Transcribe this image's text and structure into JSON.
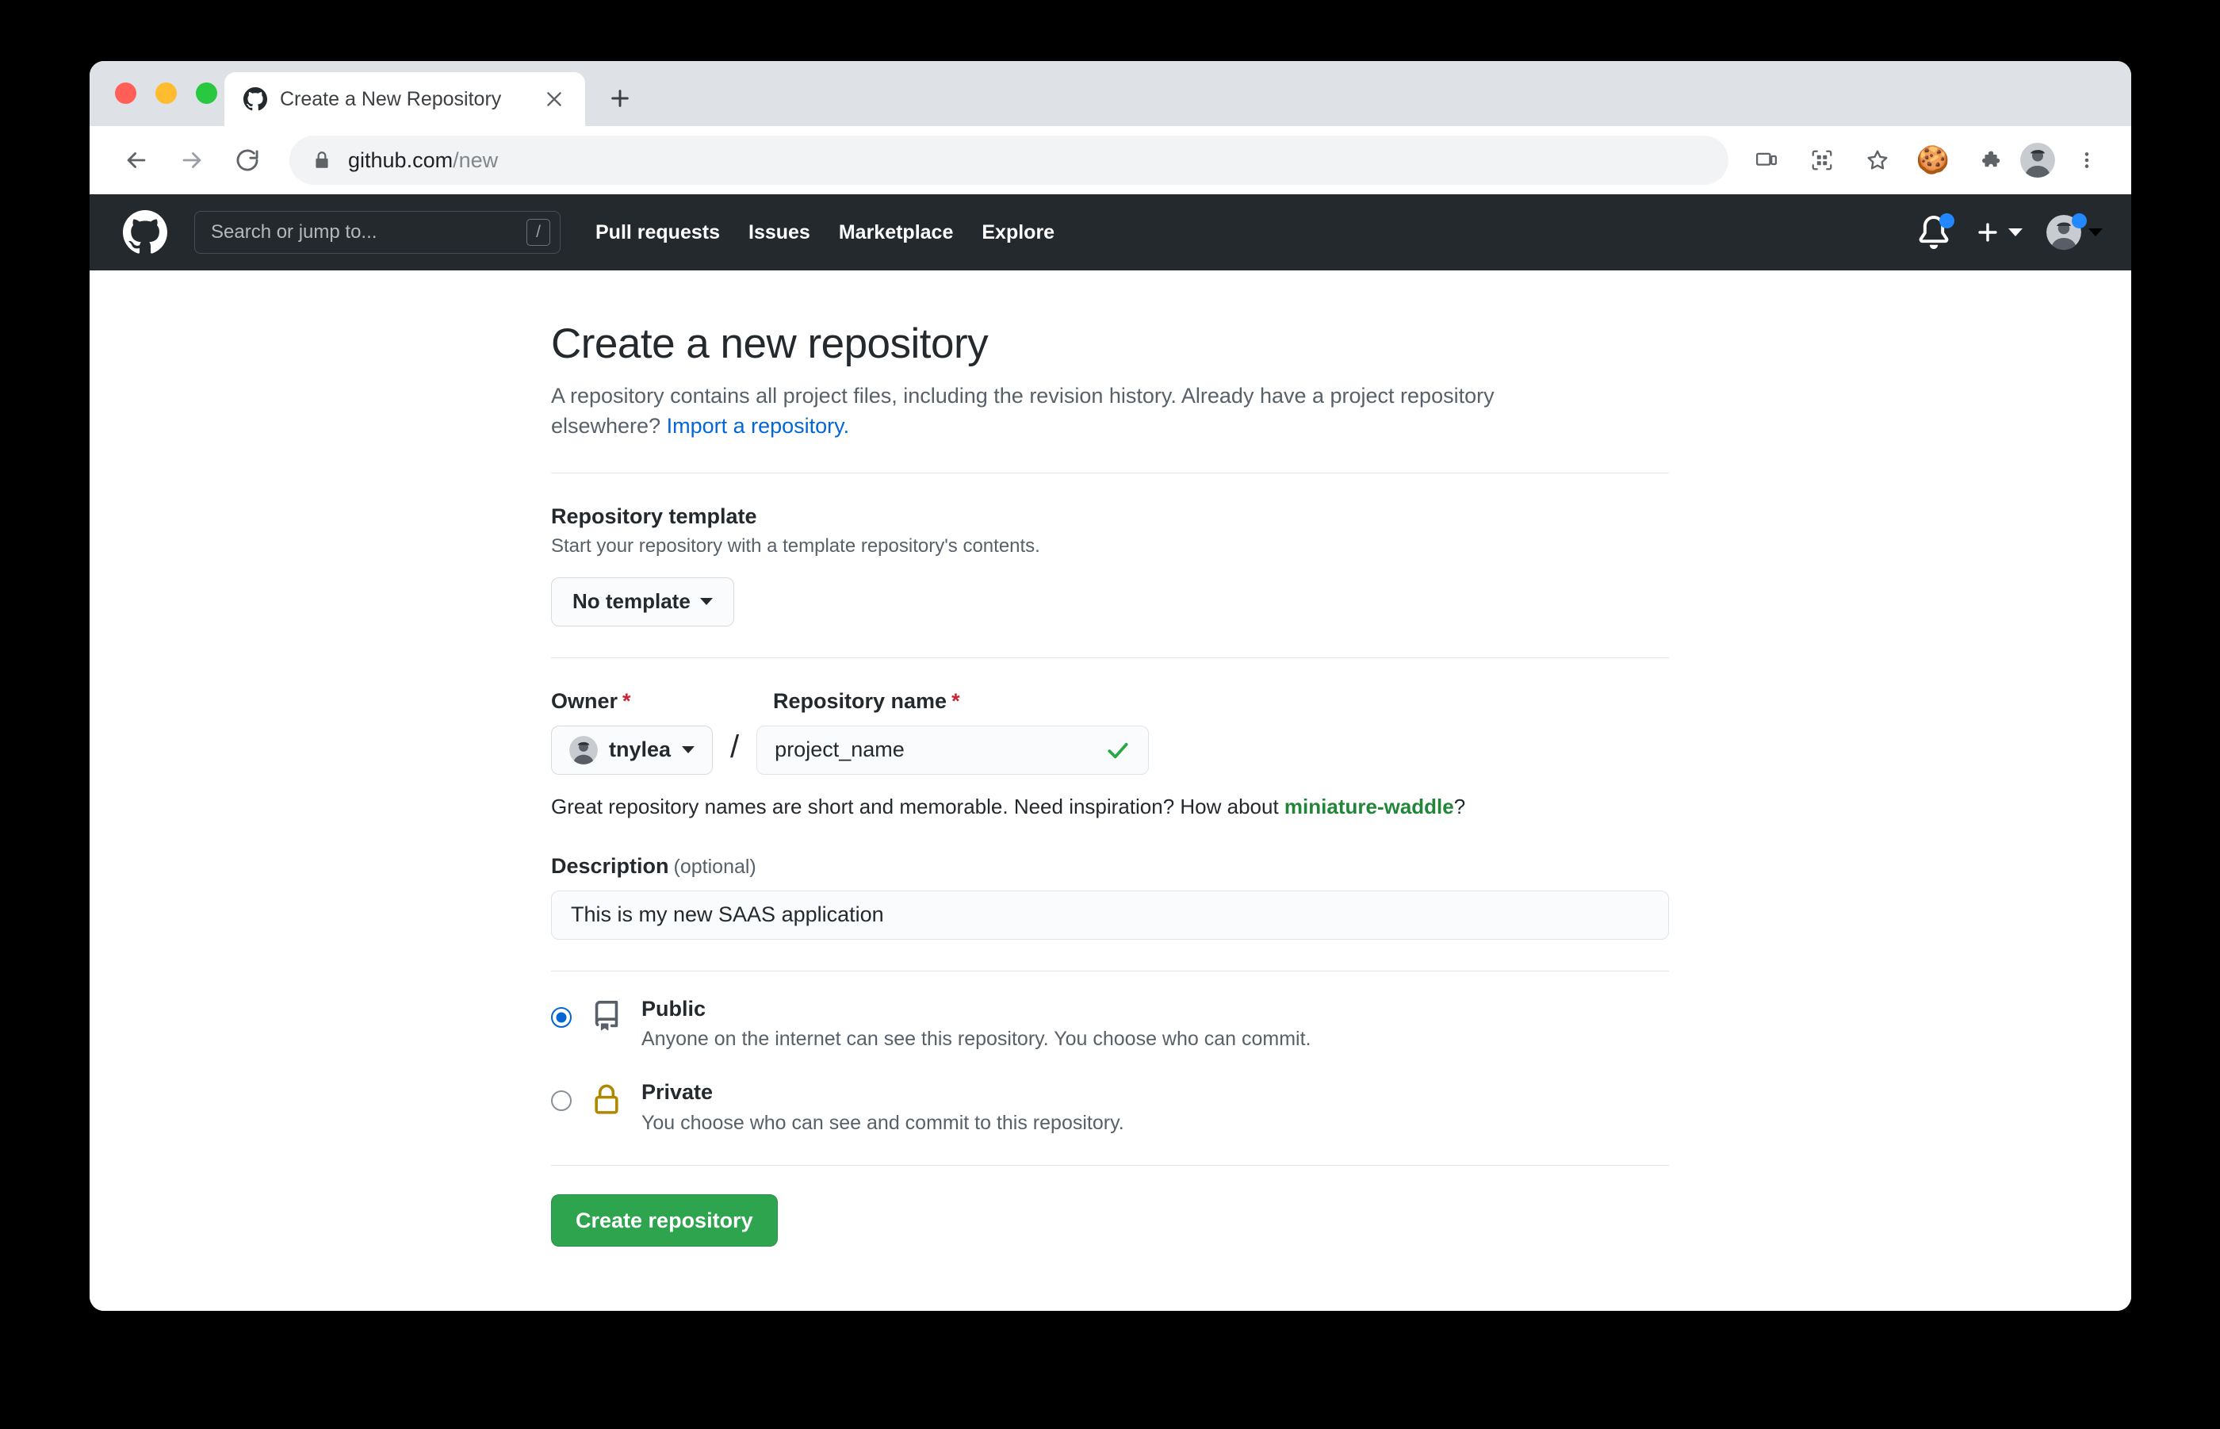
{
  "browser": {
    "tab": {
      "title": "Create a New Repository",
      "favicon": "github-icon",
      "close": "close-icon"
    },
    "new_tab_label": "+",
    "toolbar": {
      "back": "back-arrow-icon",
      "forward": "forward-arrow-icon",
      "reload": "reload-icon",
      "lock": "lock-icon",
      "url_domain": "github.com",
      "url_path": "/new",
      "icons": [
        "cast-icon",
        "qr-code-icon",
        "star-icon",
        "cookie-icon",
        "extensions-puzzle-icon",
        "profile-avatar",
        "three-dot-menu-icon"
      ]
    }
  },
  "gh_header": {
    "logo": "github-octocat-logo",
    "search_placeholder": "Search or jump to...",
    "search_shortcut": "/",
    "nav": [
      {
        "label": "Pull requests"
      },
      {
        "label": "Issues"
      },
      {
        "label": "Marketplace"
      },
      {
        "label": "Explore"
      }
    ],
    "notifications_icon": "bell-icon",
    "create_new_icon": "plus-icon",
    "avatar": "user-avatar"
  },
  "main": {
    "title": "Create a new repository",
    "description_prefix": "A repository contains all project files, including the revision history. Already have a project repository elsewhere? ",
    "description_link": "Import a repository.",
    "template": {
      "title": "Repository template",
      "subtitle": "Start your repository with a template repository's contents.",
      "button_label": "No template"
    },
    "owner": {
      "label": "Owner",
      "required_mark": "*",
      "value": "tnylea"
    },
    "repo_name": {
      "label": "Repository name",
      "required_mark": "*",
      "value": "project_name",
      "valid_icon": "check-icon"
    },
    "separator": "/",
    "name_hint_prefix": "Great repository names are short and memorable. Need inspiration? How about ",
    "name_hint_suggestion": "miniature-waddle",
    "name_hint_suffix": "?",
    "description_field": {
      "label": "Description",
      "optional": "(optional)",
      "value": "This is my new SAAS application"
    },
    "visibility": [
      {
        "id": "public",
        "title": "Public",
        "subtitle": "Anyone on the internet can see this repository. You choose who can commit.",
        "icon": "repo-book-icon",
        "selected": true
      },
      {
        "id": "private",
        "title": "Private",
        "subtitle": "You choose who can see and commit to this repository.",
        "icon": "lock-icon",
        "selected": false
      }
    ],
    "submit_label": "Create repository"
  },
  "colors": {
    "gh_header_bg": "#24292e",
    "accent_green": "#2ea44f",
    "link_blue": "#0366d6",
    "suggest_green": "#22863a",
    "required_red": "#cb2431",
    "radio_blue": "#0366d6",
    "private_lock_gold": "#b08800"
  }
}
